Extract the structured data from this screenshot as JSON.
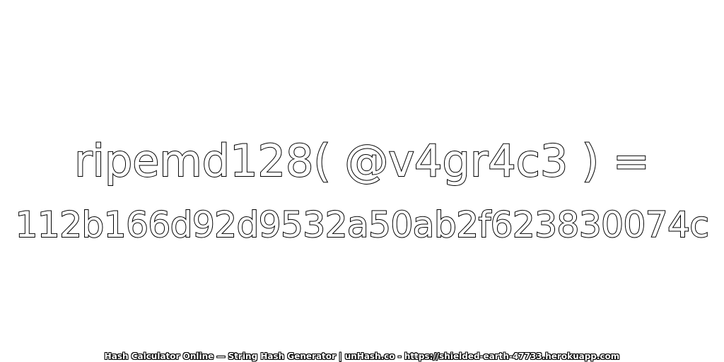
{
  "formula": "ripemd128( @v4gr4c3 ) =",
  "digest": "112b166d92d9532a50ab2f623830074c",
  "footer": "Hash Calculator Online — String Hash Generator | unHash.co - https://shielded-earth-47733.herokuapp.com",
  "colors": {
    "background": "#ffffff",
    "text_fill": "#ffffff",
    "text_outline": "#000000"
  }
}
